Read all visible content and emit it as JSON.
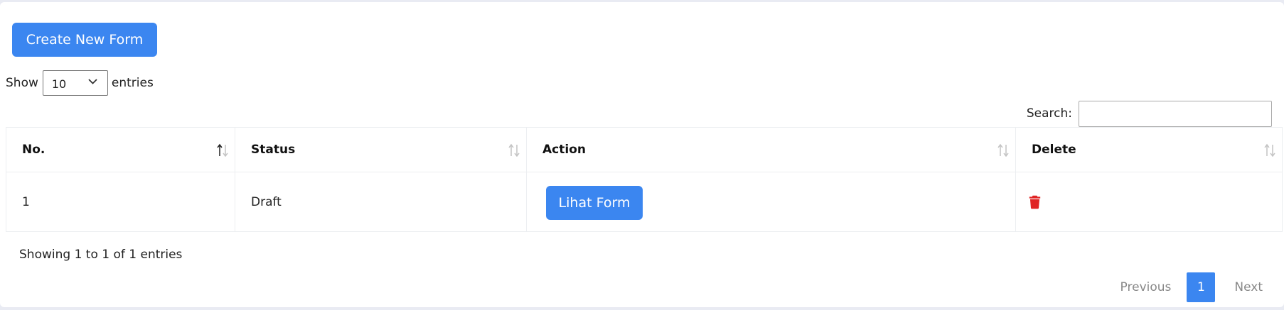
{
  "create_button": {
    "label": "Create New Form"
  },
  "length_menu": {
    "prefix": "Show",
    "selected": "10",
    "suffix": "entries"
  },
  "search": {
    "label": "Search:",
    "value": ""
  },
  "table": {
    "columns": [
      "No.",
      "Status",
      "Action",
      "Delete"
    ],
    "rows": [
      {
        "no": "1",
        "status": "Draft",
        "action_label": "Lihat Form",
        "delete_icon": "trash-icon"
      }
    ]
  },
  "info": "Showing 1 to 1 of 1 entries",
  "pagination": {
    "previous": "Previous",
    "current": "1",
    "next": "Next"
  },
  "colors": {
    "primary": "#3b86f0",
    "danger": "#e02424",
    "muted": "#9a9a9a"
  }
}
